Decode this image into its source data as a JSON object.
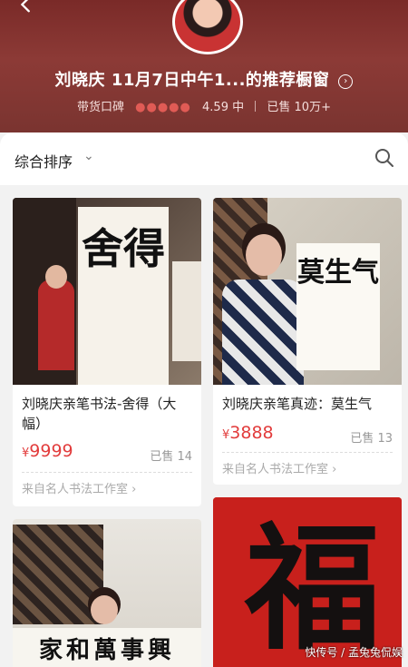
{
  "header": {
    "title": "刘晓庆 11月7日中午1...的推荐橱窗",
    "reputation_label": "带货口碑",
    "rating": "4.59",
    "rating_level": "中",
    "sold_summary": "已售 10万+",
    "star_count": 5
  },
  "sortbar": {
    "sort_label": "综合排序"
  },
  "products": [
    {
      "name": "刘晓庆亲笔书法-舍得（大幅）",
      "price_symbol": "¥",
      "price": "9999",
      "sold": "已售 14",
      "shop": "来自名人书法工作室",
      "calligraphy": "舍得"
    },
    {
      "name": "刘晓庆亲笔真迹：莫生气",
      "price_symbol": "¥",
      "price": "3888",
      "sold": "已售 13",
      "shop": "来自名人书法工作室",
      "calligraphy": "莫生气"
    },
    {
      "calligraphy": "家和萬事興"
    },
    {
      "calligraphy": "福"
    }
  ],
  "watermark": "快传号 / 孟兔兔侃娱",
  "colors": {
    "header_bg": "#7a2a28",
    "price_red": "#e23c3c",
    "fu_red": "#c8201c"
  }
}
